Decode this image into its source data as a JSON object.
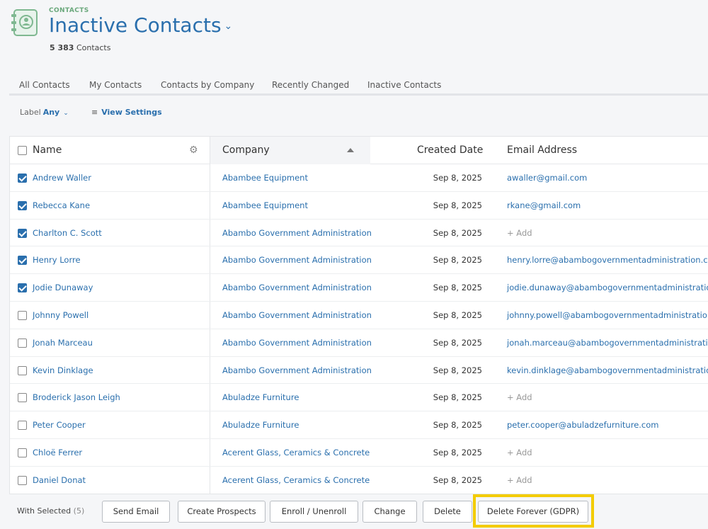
{
  "header": {
    "section": "CONTACTS",
    "title": "Inactive Contacts",
    "count_number": "5 383",
    "count_label": "Contacts"
  },
  "tabs": [
    {
      "label": "All Contacts"
    },
    {
      "label": "My Contacts"
    },
    {
      "label": "Contacts by Company"
    },
    {
      "label": "Recently Changed"
    },
    {
      "label": "Inactive Contacts"
    }
  ],
  "filters": {
    "label_text": "Label",
    "label_value": "Any",
    "view_settings": "View Settings"
  },
  "table": {
    "columns": {
      "name": "Name",
      "company": "Company",
      "created": "Created Date",
      "email": "Email Address"
    },
    "rows": [
      {
        "name": "Andrew Waller",
        "company": "Abambee Equipment",
        "date": "Sep 8, 2025",
        "email": "awaller@gmail.com",
        "checked": true
      },
      {
        "name": "Rebecca Kane",
        "company": "Abambee Equipment",
        "date": "Sep 8, 2025",
        "email": "rkane@gmail.com",
        "checked": true
      },
      {
        "name": "Charlton C. Scott",
        "company": "Abambo Government Administration",
        "date": "Sep 8, 2025",
        "email": "+ Add",
        "checked": true
      },
      {
        "name": "Henry Lorre",
        "company": "Abambo Government Administration",
        "date": "Sep 8, 2025",
        "email": "henry.lorre@abambogovernmentadministration.co",
        "checked": true
      },
      {
        "name": "Jodie Dunaway",
        "company": "Abambo Government Administration",
        "date": "Sep 8, 2025",
        "email": "jodie.dunaway@abambogovernmentadministratio",
        "checked": true
      },
      {
        "name": "Johnny Powell",
        "company": "Abambo Government Administration",
        "date": "Sep 8, 2025",
        "email": "johnny.powell@abambogovernmentadministratio",
        "checked": false
      },
      {
        "name": "Jonah Marceau",
        "company": "Abambo Government Administration",
        "date": "Sep 8, 2025",
        "email": "jonah.marceau@abambogovernmentadministratio",
        "checked": false
      },
      {
        "name": "Kevin Dinklage",
        "company": "Abambo Government Administration",
        "date": "Sep 8, 2025",
        "email": "kevin.dinklage@abambogovernmentadministratio",
        "checked": false
      },
      {
        "name": "Broderick Jason Leigh",
        "company": "Abuladze Furniture",
        "date": "Sep 8, 2025",
        "email": "+ Add",
        "checked": false
      },
      {
        "name": "Peter Cooper",
        "company": "Abuladze Furniture",
        "date": "Sep 8, 2025",
        "email": "peter.cooper@abuladzefurniture.com",
        "checked": false
      },
      {
        "name": "Chloë Ferrer",
        "company": "Acerent Glass, Ceramics & Concrete",
        "date": "Sep 8, 2025",
        "email": "+ Add",
        "checked": false
      },
      {
        "name": "Daniel Donat",
        "company": "Acerent Glass, Ceramics & Concrete",
        "date": "Sep 8, 2025",
        "email": "+ Add",
        "checked": false
      }
    ]
  },
  "bottom": {
    "with_selected": "With Selected",
    "selected_count": "(5)",
    "buttons": {
      "send_email": "Send Email",
      "create_prospects": "Create Prospects",
      "enroll": "Enroll / Unenroll",
      "change": "Change",
      "delete": "Delete",
      "delete_forever": "Delete Forever (GDPR)"
    }
  },
  "colors": {
    "accent": "#2a6fad",
    "brand_green": "#6aa87c",
    "highlight": "#f3cc00"
  },
  "icons": [
    "contacts-book-icon",
    "chevron-down-icon",
    "sliders-icon",
    "gear-icon",
    "sort-asc-icon",
    "checkbox-icon"
  ]
}
